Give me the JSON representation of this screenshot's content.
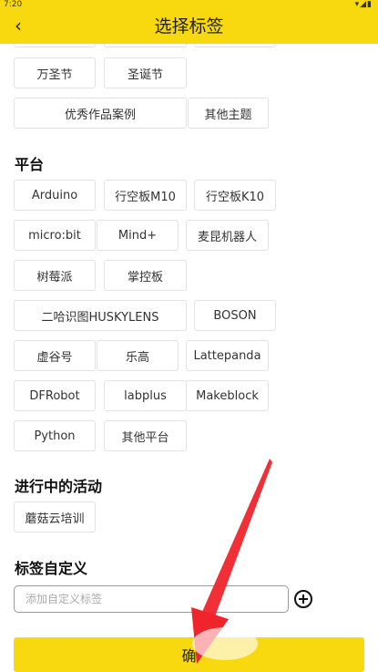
{
  "status_bar": {
    "time": "7:20",
    "icons_text": "▾◢▮"
  },
  "header": {
    "back_icon": "‹",
    "title": "选择标签"
  },
  "top_tags": [
    "万圣节",
    "圣诞节",
    "优秀作品案例",
    "其他主题"
  ],
  "platform": {
    "title": "平台",
    "tags": [
      "Arduino",
      "行空板M10",
      "行空板K10",
      "micro:bit",
      "Mind+",
      "麦昆机器人",
      "树莓派",
      "掌控板",
      "二哈识图HUSKYLENS",
      "BOSON",
      "虚谷号",
      "乐高",
      "Lattepanda",
      "DFRobot",
      "labplus",
      "Makeblock",
      "Python",
      "其他平台"
    ]
  },
  "activities": {
    "title": "进行中的活动",
    "tags": [
      "蘑菇云培训"
    ]
  },
  "custom": {
    "title": "标签自定义",
    "placeholder": "添加自定义标签",
    "add_icon": "plus-circle-icon"
  },
  "confirm_button": {
    "label": "确"
  },
  "colors": {
    "accent": "#f8d80e",
    "arrow": "#f0242b"
  }
}
